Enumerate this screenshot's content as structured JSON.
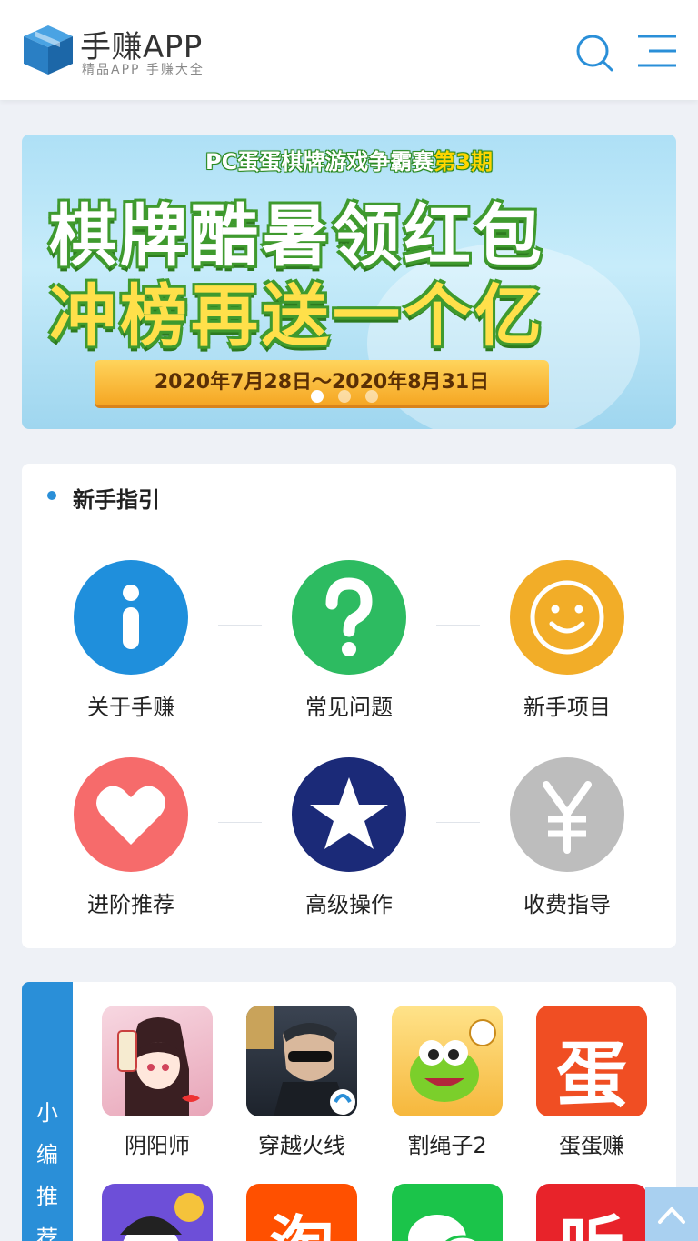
{
  "header": {
    "app_name": "手赚APP",
    "tagline": "精品APP 手赚大全"
  },
  "banner": {
    "top_line_a": "PC蛋蛋棋牌游戏争霸赛",
    "top_line_b": "第3期",
    "line1": "棋牌酷暑领红包",
    "line2": "冲榜再送一个亿",
    "date_range": "2020年7月28日～2020年8月31日",
    "slide_count": 3,
    "active_slide": 1
  },
  "guide": {
    "title": "新手指引",
    "items": [
      {
        "label": "关于手赚",
        "icon": "info-icon",
        "color": "#1f8fdc"
      },
      {
        "label": "常见问题",
        "icon": "question-icon",
        "color": "#2dbb61"
      },
      {
        "label": "新手项目",
        "icon": "smiley-icon",
        "color": "#f2ad28"
      },
      {
        "label": "进阶推荐",
        "icon": "heart-icon",
        "color": "#f66b6b"
      },
      {
        "label": "高级操作",
        "icon": "star-icon",
        "color": "#1b2a78"
      },
      {
        "label": "收费指导",
        "icon": "yen-icon",
        "color": "#bdbdbd"
      }
    ]
  },
  "picks": {
    "side_label": [
      "小",
      "编",
      "推",
      "荐"
    ],
    "apps": [
      {
        "name": "阴阳师",
        "icon": "onmyoji-app-icon"
      },
      {
        "name": "穿越火线",
        "icon": "crossfire-app-icon"
      },
      {
        "name": "割绳子2",
        "icon": "cut-the-rope-app-icon"
      },
      {
        "name": "蛋蛋赚",
        "icon": "dandanzhuan-app-icon",
        "glyph": "蛋"
      },
      {
        "name": "",
        "icon": "money-cartoon-app-icon"
      },
      {
        "name": "",
        "icon": "taobao-app-icon",
        "glyph": "淘"
      },
      {
        "name": "",
        "icon": "wechat-app-icon"
      },
      {
        "name": "",
        "icon": "listen-app-icon",
        "glyph": "听"
      }
    ]
  },
  "colors": {
    "accent": "#2a8fd8",
    "background": "#eef1f6"
  }
}
